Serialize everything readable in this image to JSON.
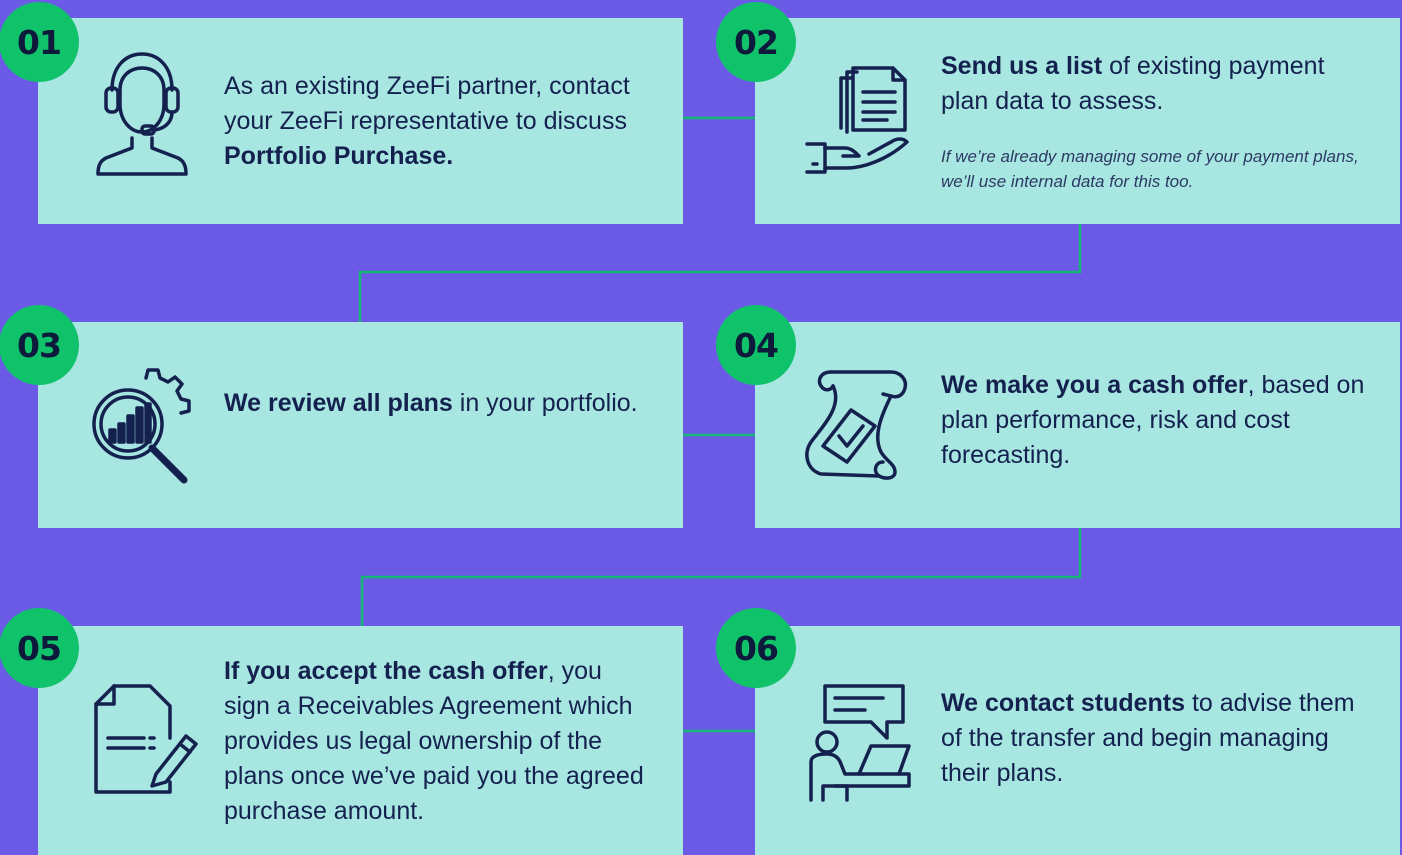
{
  "colors": {
    "background": "#6A5AE6",
    "card": "#A8E6E2",
    "badge": "#10C36B",
    "connector": "#16B776",
    "ink": "#14214E"
  },
  "steps": [
    {
      "number": "01",
      "icon": "headset-support-icon",
      "text_lead": "As an existing ZeeFi partner, contact your ZeeFi representative to discuss ",
      "text_bold": "Portfolio Purchase.",
      "text_tail": ""
    },
    {
      "number": "02",
      "icon": "document-on-hand-icon",
      "text_lead": "",
      "text_bold": "Send us a list",
      "text_tail": " of existing payment plan data to assess.",
      "note": "If we’re already managing some of your payment plans, we’ll use internal data for this too."
    },
    {
      "number": "03",
      "icon": "magnifier-analytics-gear-icon",
      "text_lead": "",
      "text_bold": "We review all plans",
      "text_tail": " in your portfolio."
    },
    {
      "number": "04",
      "icon": "scroll-checkmark-icon",
      "text_lead": "",
      "text_bold": "We make you a cash offer",
      "text_tail": ", based on plan performance, risk and cost forecasting."
    },
    {
      "number": "05",
      "icon": "contract-pen-icon",
      "text_lead": "",
      "text_bold": "If you accept the cash offer",
      "text_tail": ", you sign a Receivables Agreement which provides us legal ownership of the plans once we’ve paid you the agreed purchase amount."
    },
    {
      "number": "06",
      "icon": "person-laptop-chat-icon",
      "text_lead": "",
      "text_bold": "We contact students",
      "text_tail": " to advise them of the transfer and begin managing their plans."
    }
  ]
}
